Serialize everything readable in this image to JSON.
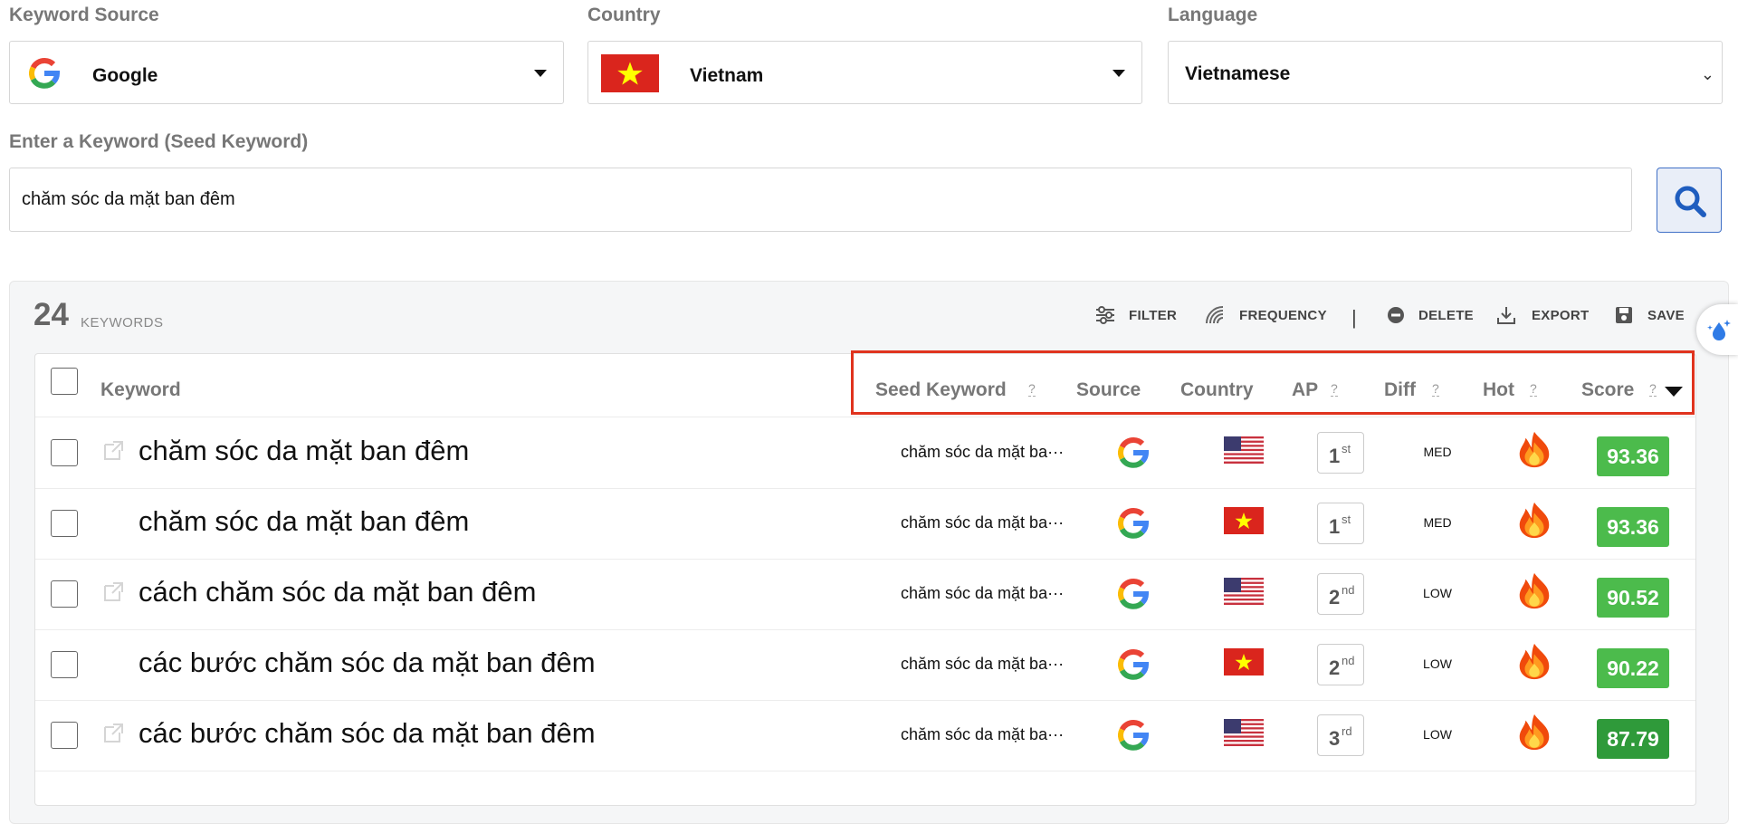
{
  "filters": {
    "source_label": "Keyword Source",
    "source_value": "Google",
    "country_label": "Country",
    "country_value": "Vietnam",
    "language_label": "Language",
    "language_value": "Vietnamese",
    "seed_label": "Enter a Keyword (Seed Keyword)",
    "seed_value": "chăm sóc da mặt ban đêm"
  },
  "results": {
    "count": "24",
    "count_label": "KEYWORDS"
  },
  "toolbar": {
    "filter": "FILTER",
    "frequency": "FREQUENCY",
    "separator": "|",
    "delete": "DELETE",
    "export": "EXPORT",
    "save": "SAVE"
  },
  "table": {
    "headers": {
      "keyword": "Keyword",
      "seed": "Seed Keyword",
      "source": "Source",
      "country": "Country",
      "ap": "AP",
      "diff": "Diff",
      "hot": "Hot",
      "score": "Score",
      "help": "?"
    },
    "rows": [
      {
        "keyword": "chăm sóc da mặt ban đêm",
        "seed": "chăm sóc da mặt ba···",
        "country_flag": "us-flag",
        "ap_num": "1",
        "ap_suffix": "st",
        "diff": "MED",
        "score": "93.36",
        "score_color": "#4cbb4c",
        "link_icon": true
      },
      {
        "keyword": "chăm sóc da mặt ban đêm",
        "seed": "chăm sóc da mặt ba···",
        "country_flag": "vn-flag",
        "ap_num": "1",
        "ap_suffix": "st",
        "diff": "MED",
        "score": "93.36",
        "score_color": "#4cbb4c",
        "link_icon": false
      },
      {
        "keyword": "cách chăm sóc da mặt ban đêm",
        "seed": "chăm sóc da mặt ba···",
        "country_flag": "us-flag",
        "ap_num": "2",
        "ap_suffix": "nd",
        "diff": "LOW",
        "score": "90.52",
        "score_color": "#4cbb4c",
        "link_icon": true
      },
      {
        "keyword": "các bước chăm sóc da mặt ban đêm",
        "seed": "chăm sóc da mặt ba···",
        "country_flag": "vn-flag",
        "ap_num": "2",
        "ap_suffix": "nd",
        "diff": "LOW",
        "score": "90.22",
        "score_color": "#4cbb4c",
        "link_icon": false
      },
      {
        "keyword": "các bước chăm sóc da mặt ban đêm",
        "seed": "chăm sóc da mặt ba···",
        "country_flag": "us-flag",
        "ap_num": "3",
        "ap_suffix": "rd",
        "diff": "LOW",
        "score": "87.79",
        "score_color": "#2f9a3a",
        "link_icon": true
      }
    ]
  },
  "colors": {
    "highlight": "#e0331e",
    "search_accent": "#1f5dbf",
    "score_high": "#4cbb4c",
    "score_mid": "#2f9a3a"
  }
}
